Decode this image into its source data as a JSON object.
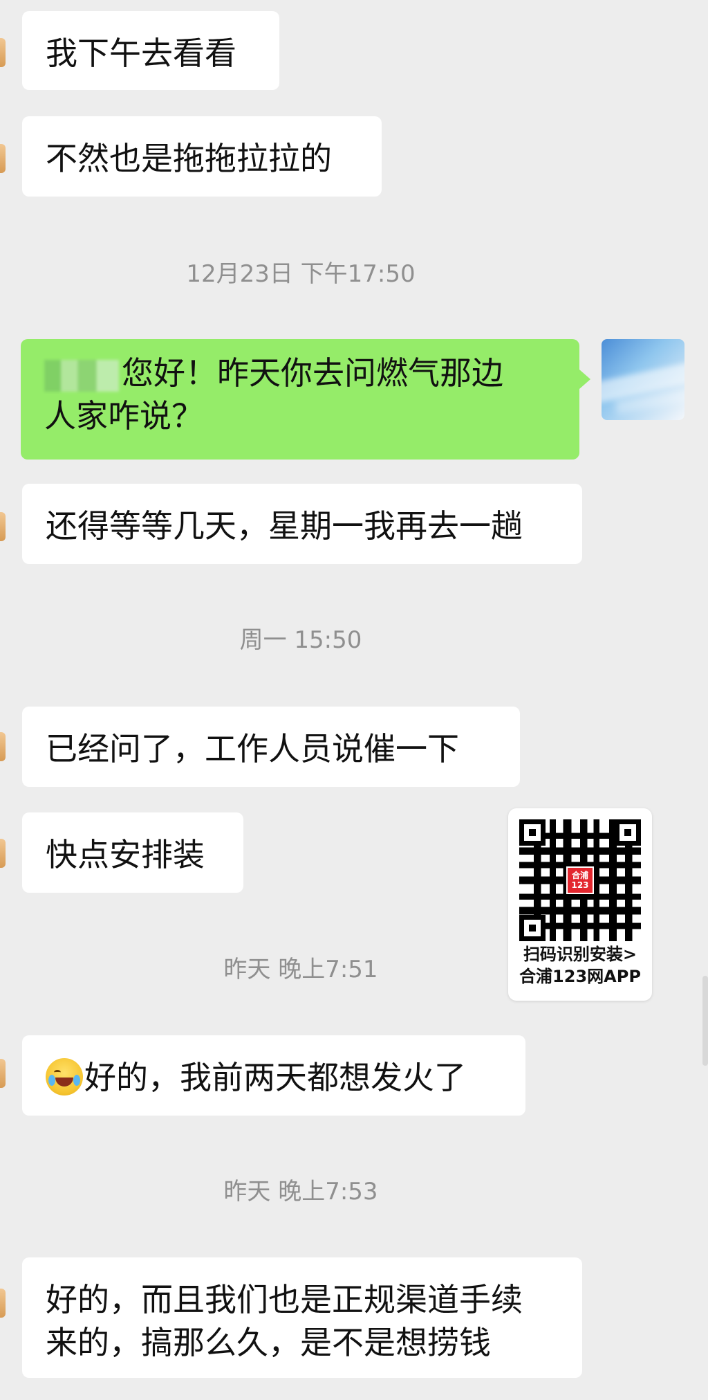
{
  "messages": [
    {
      "id": "m1",
      "text": "我下午去看看"
    },
    {
      "id": "m2",
      "text": "不然也是拖拖拉拉的"
    },
    {
      "id": "m3",
      "line1": "您好！昨天你去问燃气那边",
      "line2": "人家咋说？"
    },
    {
      "id": "m4",
      "text": "还得等等几天，星期一我再去一趟"
    },
    {
      "id": "m5",
      "text": "已经问了，工作人员说催一下"
    },
    {
      "id": "m6",
      "text": "快点安排装"
    },
    {
      "id": "m7",
      "text": "好的，我前两天都想发火了"
    },
    {
      "id": "m8",
      "line1": "好的，而且我们也是正规渠道手续",
      "line2": "来的，搞那么久，是不是想捞钱"
    }
  ],
  "timestamps": {
    "t1": "12月23日 下午17:50",
    "t2": "周一 15:50",
    "t3": "昨天 晚上7:51",
    "t4": "昨天 晚上7:53"
  },
  "qr_card": {
    "logo_text": "合浦123",
    "line1": "扫码识别安装>",
    "line2": "合浦123网APP"
  },
  "icons": {
    "avatar": "sky-photo-avatar",
    "emoji": "tears-of-joy-emoji",
    "qr": "qr-code-icon"
  },
  "colors": {
    "background": "#ededed",
    "incoming_bubble": "#ffffff",
    "outgoing_bubble": "#95ec69",
    "timestamp": "#8f8f8f"
  }
}
